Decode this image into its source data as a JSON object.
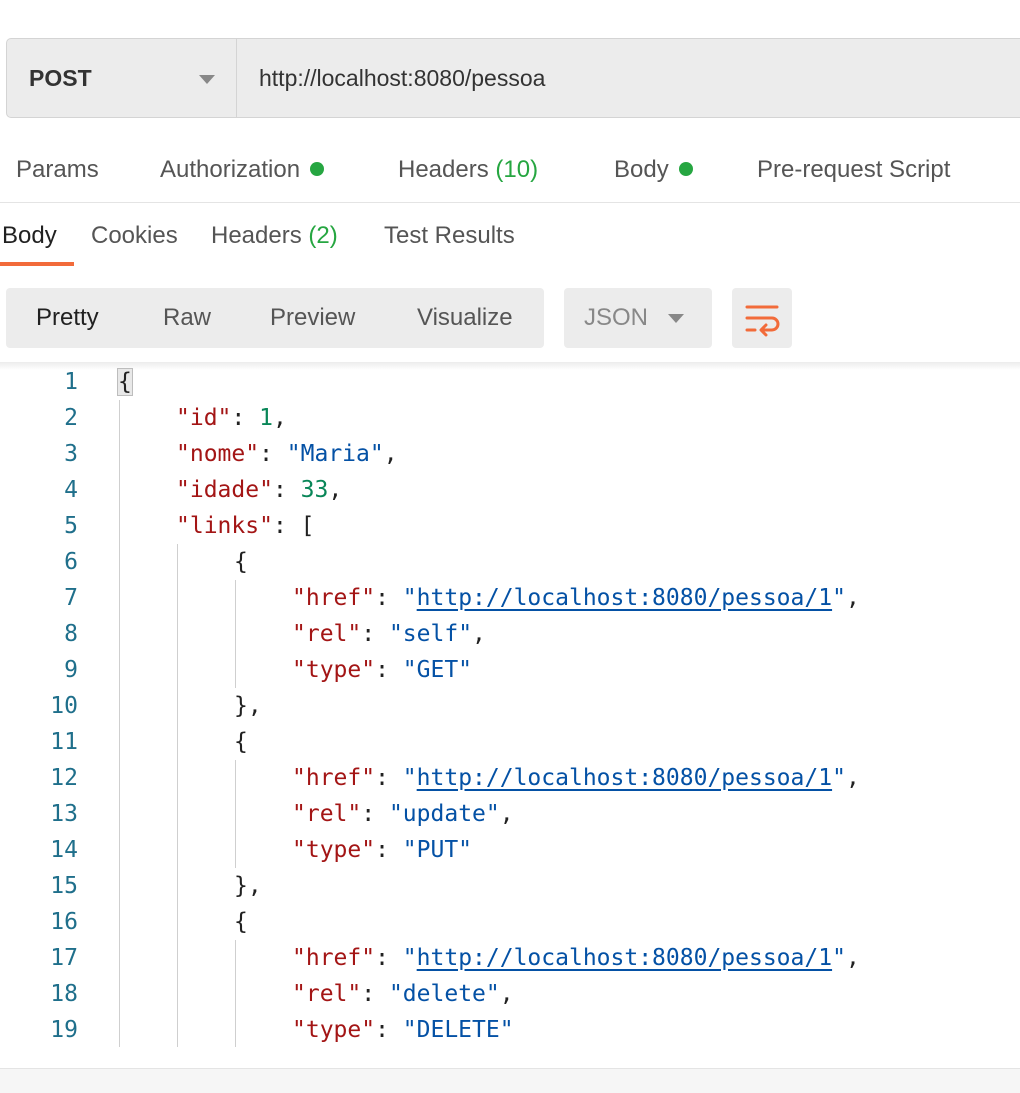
{
  "request": {
    "method": "POST",
    "url": "http://localhost:8080/pessoa"
  },
  "request_tabs": [
    {
      "label": "Params"
    },
    {
      "label": "Authorization",
      "dot": true
    },
    {
      "label": "Headers",
      "count": "(10)"
    },
    {
      "label": "Body",
      "dot": true
    },
    {
      "label": "Pre-request Script"
    }
  ],
  "response_tabs": [
    {
      "label": "Body"
    },
    {
      "label": "Cookies"
    },
    {
      "label": "Headers",
      "count": "(2)"
    },
    {
      "label": "Test Results"
    }
  ],
  "format_buttons": [
    "Pretty",
    "Raw",
    "Preview",
    "Visualize"
  ],
  "language": "JSON",
  "colors": {
    "accent": "#f26b3a",
    "green_dot": "#26a641",
    "key": "#a31515",
    "string": "#0451a5",
    "number": "#098658",
    "line_number": "#1f6f8b"
  },
  "code_lines": [
    {
      "n": "1",
      "t": "{"
    },
    {
      "n": "2",
      "t": "\"id\": 1,"
    },
    {
      "n": "3",
      "t": "\"nome\": \"Maria\","
    },
    {
      "n": "4",
      "t": "\"idade\": 33,"
    },
    {
      "n": "5",
      "t": "\"links\": ["
    },
    {
      "n": "6",
      "t": "{"
    },
    {
      "n": "7",
      "t": "\"href\": \"http://localhost:8080/pessoa/1\","
    },
    {
      "n": "8",
      "t": "\"rel\": \"self\","
    },
    {
      "n": "9",
      "t": "\"type\": \"GET\""
    },
    {
      "n": "10",
      "t": "},"
    },
    {
      "n": "11",
      "t": "{"
    },
    {
      "n": "12",
      "t": "\"href\": \"http://localhost:8080/pessoa/1\","
    },
    {
      "n": "13",
      "t": "\"rel\": \"update\","
    },
    {
      "n": "14",
      "t": "\"type\": \"PUT\""
    },
    {
      "n": "15",
      "t": "},"
    },
    {
      "n": "16",
      "t": "{"
    },
    {
      "n": "17",
      "t": "\"href\": \"http://localhost:8080/pessoa/1\","
    },
    {
      "n": "18",
      "t": "\"rel\": \"delete\","
    },
    {
      "n": "19",
      "t": "\"type\": \"DELETE\""
    }
  ]
}
